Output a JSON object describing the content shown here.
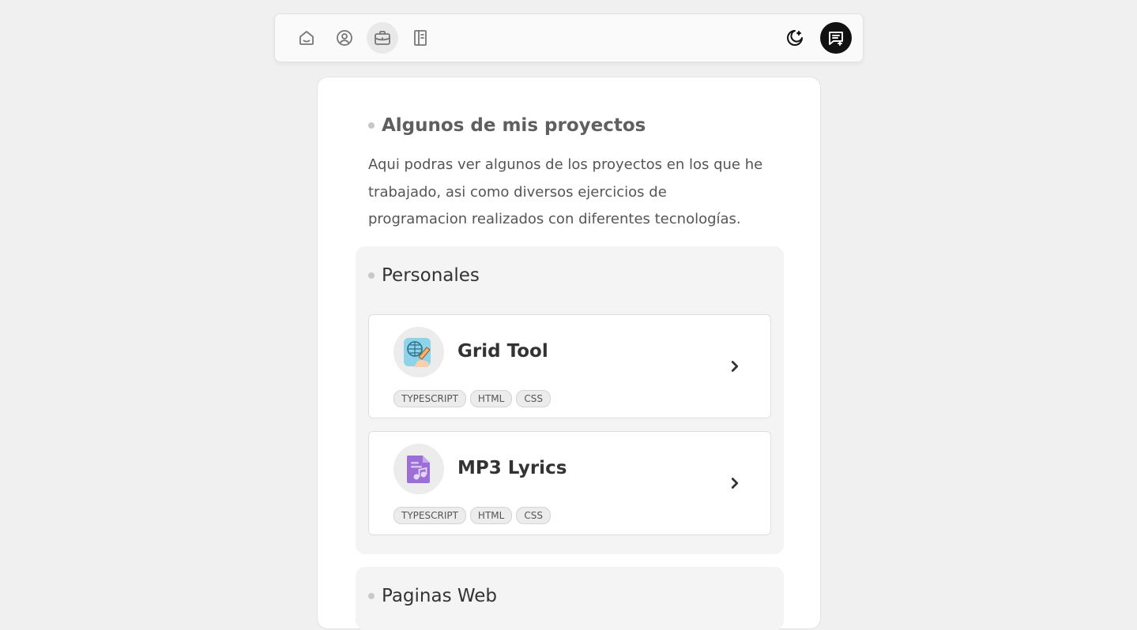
{
  "nav": {
    "items": [
      {
        "icon": "home-icon",
        "active": false
      },
      {
        "icon": "user-circle-icon",
        "active": false
      },
      {
        "icon": "briefcase-icon",
        "active": true
      },
      {
        "icon": "notebook-icon",
        "active": false
      }
    ],
    "theme_icon": "moon-icon",
    "chat_icon": "message-plus-icon"
  },
  "main": {
    "title": "Algunos de mis proyectos",
    "intro": "Aqui podras ver algunos de los proyectos en los que he trabajado, asi como diversos ejercicios de programacion realizados con diferentes tecnologías.",
    "groups": [
      {
        "title": "Personales",
        "projects": [
          {
            "title": "Grid Tool",
            "icon": "grid-tool-icon",
            "tags": [
              "TYPESCRIPT",
              "HTML",
              "CSS"
            ]
          },
          {
            "title": "MP3 Lyrics",
            "icon": "music-file-icon",
            "tags": [
              "TYPESCRIPT",
              "HTML",
              "CSS"
            ]
          }
        ]
      },
      {
        "title": "Paginas Web",
        "projects": []
      }
    ]
  },
  "colors": {
    "background": "#f0f0f0",
    "card": "#ffffff",
    "group": "#f4f4f4",
    "accent_dark": "#111111",
    "music_icon": "#9b6fd6"
  }
}
